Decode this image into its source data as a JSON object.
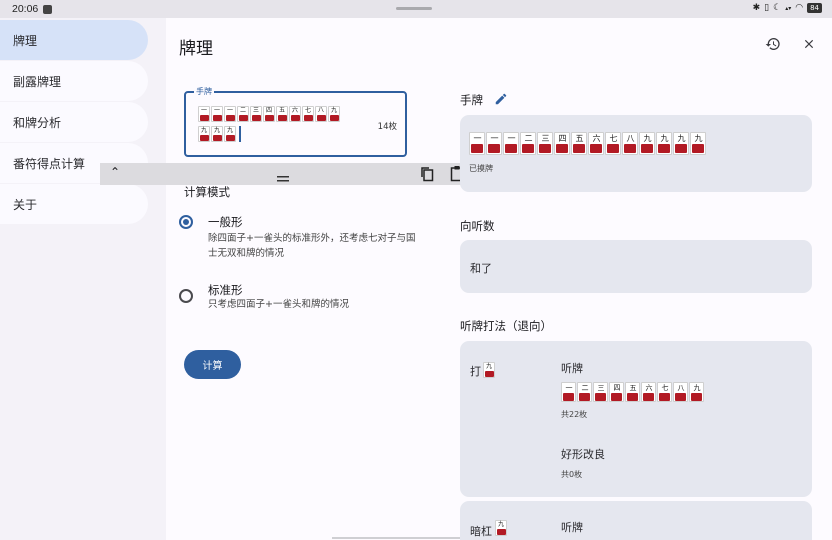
{
  "status": {
    "time": "20:06",
    "battery": "84"
  },
  "sidebar": {
    "items": [
      {
        "label": "牌理",
        "active": true
      },
      {
        "label": "副露牌理",
        "active": false
      },
      {
        "label": "和牌分析",
        "active": false
      },
      {
        "label": "番符得点计算",
        "active": false
      },
      {
        "label": "关于",
        "active": false
      }
    ]
  },
  "appbar": {
    "title": "牌理",
    "icons": [
      "history-icon",
      "close-icon"
    ]
  },
  "hand_input": {
    "legend": "手牌",
    "count": "14枚",
    "row1": [
      "一",
      "一",
      "一",
      "二",
      "三",
      "四",
      "五",
      "六",
      "七",
      "八",
      "九"
    ],
    "row2": [
      "九",
      "九",
      "九"
    ]
  },
  "calc_mode": {
    "label": "计算模式",
    "options": [
      {
        "title": "一般形",
        "desc": "除四面子+一雀头的标准形外，还考虑七对子与国士无双和牌的情况",
        "selected": true
      },
      {
        "title": "标准形",
        "desc": "只考虑四面子+一雀头和牌的情况",
        "selected": false
      }
    ],
    "button": "计算"
  },
  "result": {
    "hand_title": "手牌",
    "hand_tiles": [
      "一",
      "一",
      "一",
      "二",
      "三",
      "四",
      "五",
      "六",
      "七",
      "八",
      "九",
      "九",
      "九",
      "九"
    ],
    "hand_note": "已摸牌",
    "shanten_title": "向听数",
    "shanten_value": "和了",
    "wait_title": "听牌打法（退向）",
    "discard_options": [
      {
        "action": "打",
        "action_tile": "九",
        "wait_label": "听牌",
        "wait_tiles": [
          "一",
          "二",
          "三",
          "四",
          "五",
          "六",
          "七",
          "八",
          "九"
        ],
        "wait_count": "共22枚",
        "improve_label": "好形改良",
        "improve_count": "共0枚"
      },
      {
        "action": "暗杠",
        "action_tile": "九",
        "wait_label": "听牌"
      }
    ]
  }
}
